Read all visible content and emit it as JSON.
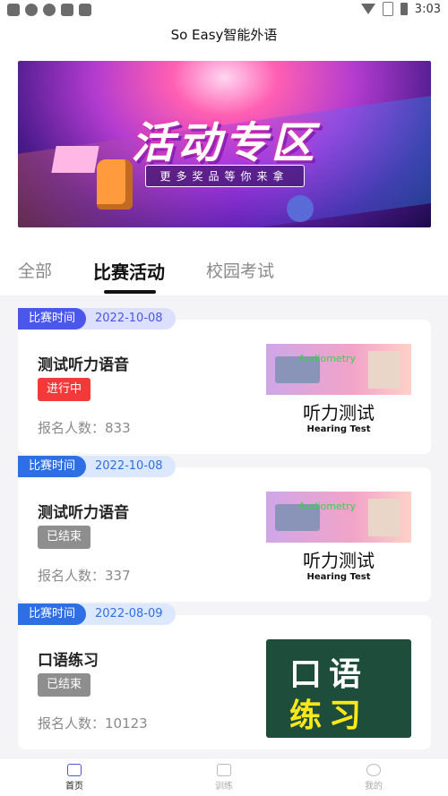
{
  "status_bar": {
    "time": "3:03"
  },
  "app": {
    "title": "So Easy智能外语"
  },
  "banner": {
    "title": "活动专区",
    "subtitle": "更多奖品等你来拿"
  },
  "tabs": [
    {
      "label": "全部"
    },
    {
      "label": "比赛活动"
    },
    {
      "label": "校园考试"
    }
  ],
  "cards": [
    {
      "tag_label": "比赛时间",
      "date": "2022-10-08",
      "name": "测试听力语音",
      "status": "进行中",
      "count_label": "报名人数：833",
      "thumb": {
        "cn": "听力测试",
        "en": "Hearing Test",
        "label": "Audiometry"
      }
    },
    {
      "tag_label": "比赛时间",
      "date": "2022-10-08",
      "name": "测试听力语音",
      "status": "已结束",
      "count_label": "报名人数：337",
      "thumb": {
        "cn": "听力测试",
        "en": "Hearing Test",
        "label": "Audiometry"
      }
    },
    {
      "tag_label": "比赛时间",
      "date": "2022-08-09",
      "name": "口语练习",
      "status": "已结束",
      "count_label": "报名人数：10123",
      "thumb": {
        "line1": "口语",
        "line2": "练习"
      }
    }
  ],
  "bottom_nav": [
    {
      "label": "首页",
      "icon": "crown-icon"
    },
    {
      "label": "训练",
      "icon": "clipboard-icon"
    },
    {
      "label": "我的",
      "icon": "user-icon"
    }
  ],
  "colors": {
    "accent": "#2f6fe6",
    "ongoing": "#f23a3a",
    "ended": "#8e8e8e"
  }
}
